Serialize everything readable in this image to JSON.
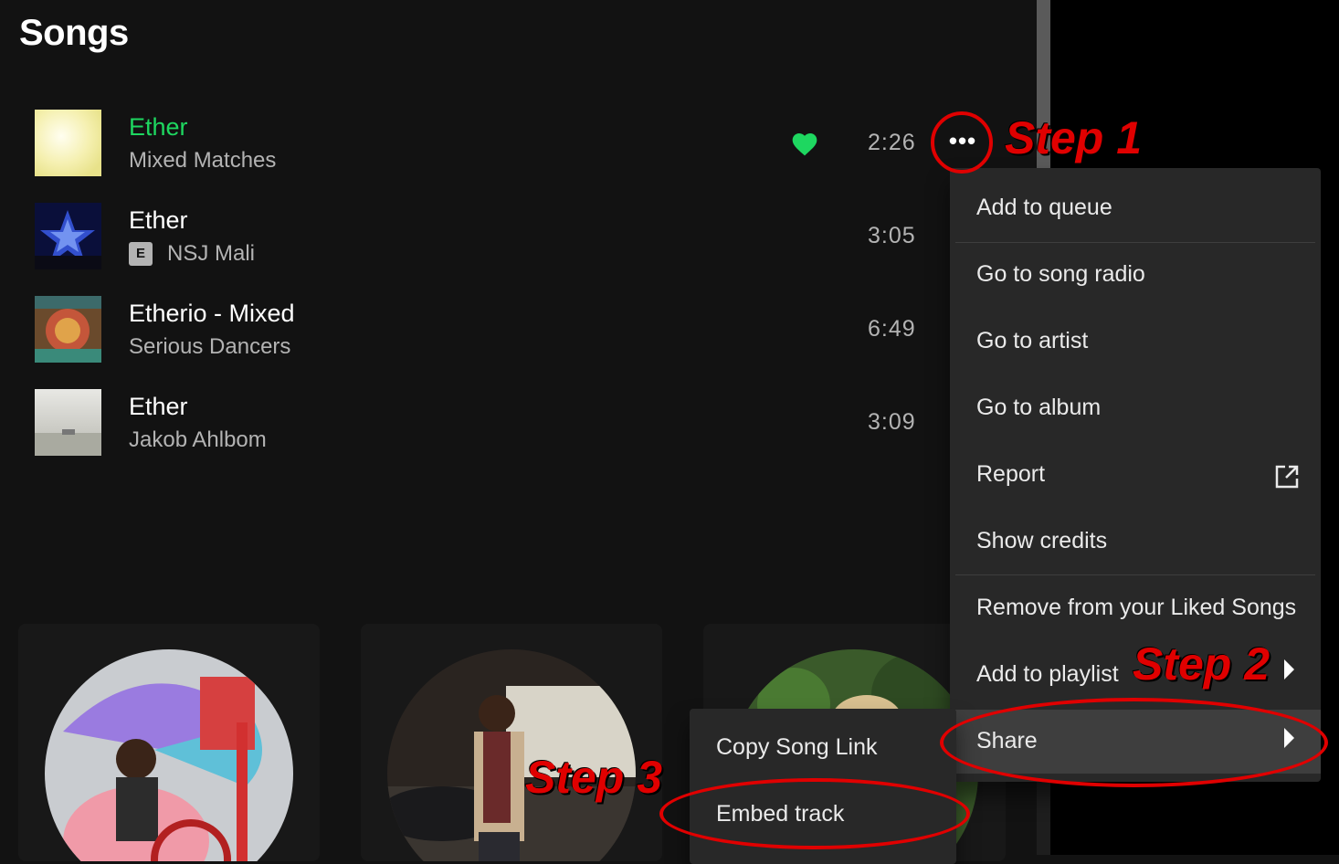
{
  "page": {
    "title": "Songs"
  },
  "tracks": [
    {
      "title": "Ether",
      "artist": "Mixed Matches",
      "duration": "2:26",
      "playing": true,
      "liked": true,
      "explicit": false,
      "cover_color": "#f2f0c8"
    },
    {
      "title": "Ether",
      "artist": "NSJ Mali",
      "duration": "3:05",
      "playing": false,
      "liked": false,
      "explicit": true,
      "explicit_label": "E",
      "cover_color": "#1c2d8a"
    },
    {
      "title": "Etherio - Mixed",
      "artist": "Serious Dancers",
      "duration": "6:49",
      "playing": false,
      "liked": false,
      "explicit": false,
      "cover_color": "#8a5a3a"
    },
    {
      "title": "Ether",
      "artist": "Jakob Ahlbom",
      "duration": "3:09",
      "playing": false,
      "liked": false,
      "explicit": false,
      "cover_color": "#cfcfc9"
    }
  ],
  "more_button": {
    "icon": "ellipsis-icon",
    "label": "•••"
  },
  "context_menu": {
    "items": [
      {
        "label": "Add to queue"
      },
      {
        "label": "Go to song radio"
      },
      {
        "label": "Go to artist"
      },
      {
        "label": "Go to album"
      },
      {
        "label": "Report",
        "icon": "external-link-icon"
      },
      {
        "label": "Show credits"
      },
      {
        "label": "Remove from your Liked Songs"
      },
      {
        "label": "Add to playlist",
        "icon": "chevron-right-icon"
      },
      {
        "label": "Share",
        "icon": "chevron-right-icon",
        "active": true
      }
    ]
  },
  "share_submenu": {
    "items": [
      {
        "label": "Copy Song Link"
      },
      {
        "label": "Embed track"
      }
    ]
  },
  "annotations": {
    "step1": "Step 1",
    "step2": "Step 2",
    "step3": "Step 3",
    "color": "#e00000"
  },
  "colors": {
    "accent": "#1ed760",
    "background": "#121212",
    "menu": "#282828",
    "menu_hover": "#3e3e3e"
  }
}
